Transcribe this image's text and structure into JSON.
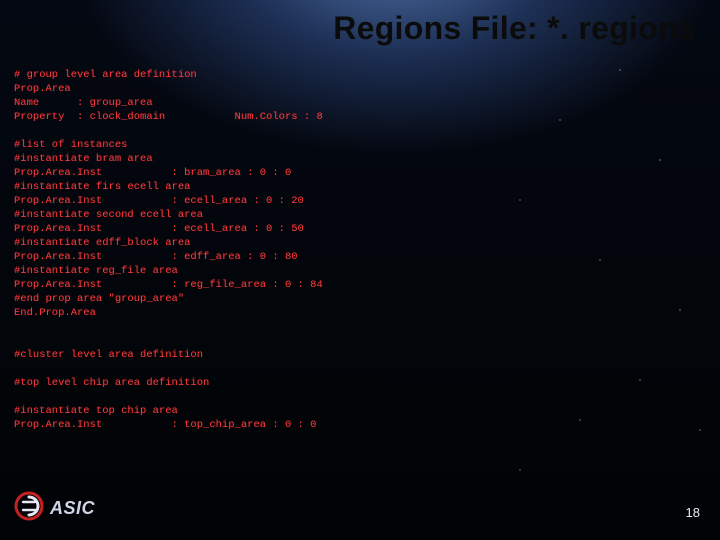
{
  "slide": {
    "title": "Regions File: *. regions",
    "page_number": "18"
  },
  "logo": {
    "text": "ASIC",
    "icon_name": "logo-easic"
  },
  "code_lines": [
    "# group level area definition",
    "Prop.Area",
    "Name      : group_area",
    "Property  : clock_domain           Num.Colors : 8",
    "",
    "#list of instances",
    "#instantiate bram area",
    "Prop.Area.Inst           : bram_area : 0 : 0",
    "#instantiate firs ecell area",
    "Prop.Area.Inst           : ecell_area : 0 : 20",
    "#instantiate second ecell area",
    "Prop.Area.Inst           : ecell_area : 0 : 50",
    "#instantiate edff_block area",
    "Prop.Area.Inst           : edff_area : 0 : 80",
    "#instantiate reg_file area",
    "Prop.Area.Inst           : reg_file_area : 0 : 84",
    "#end prop area \"group_area\"",
    "End.Prop.Area",
    "",
    "",
    "#cluster level area definition",
    "",
    "#top level chip area definition",
    "",
    "#instantiate top chip area",
    "Prop.Area.Inst           : top_chip_area : 0 : 0"
  ]
}
